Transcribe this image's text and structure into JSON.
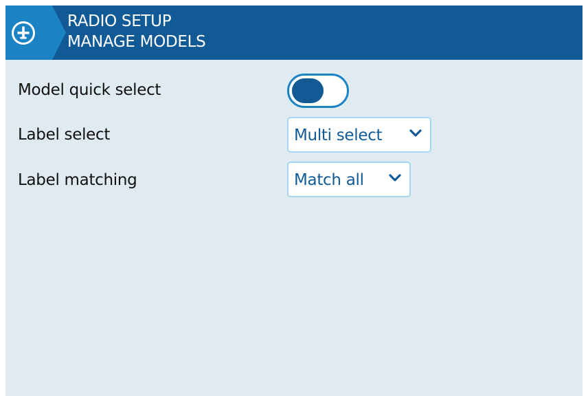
{
  "header": {
    "title_line1": "RADIO SETUP",
    "title_line2": "MANAGE MODELS",
    "icon": "airplane-icon"
  },
  "settings": {
    "model_quick_select": {
      "label": "Model quick select",
      "enabled": false
    },
    "label_select": {
      "label": "Label select",
      "value": "Multi select"
    },
    "label_matching": {
      "label": "Label matching",
      "value": "Match all"
    }
  },
  "colors": {
    "header_background": "#125a96",
    "icon_tab": "#1b82c3",
    "screen_background": "#e0eaf1",
    "accent": "#125a96",
    "control_border": "#a6d6ef"
  }
}
